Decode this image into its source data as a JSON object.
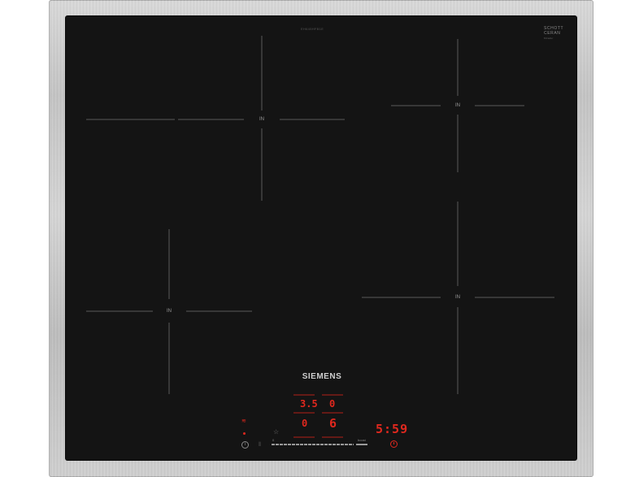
{
  "product": {
    "brand": "SIEMENS",
    "model_code": "EH645HFB1E",
    "glass_brand": "SCHOTT",
    "glass_line": "CERAN",
    "glass_sub": "Miradur"
  },
  "zones": [
    {
      "label": "IN"
    },
    {
      "label": "IN"
    },
    {
      "label": "IN"
    },
    {
      "label": "IN"
    }
  ],
  "controls": {
    "zone_displays": [
      {
        "value": "3.5"
      },
      {
        "value": "0"
      },
      {
        "value": "0"
      },
      {
        "value": "6"
      }
    ],
    "timer": "5:59",
    "slider_min_label": "0",
    "slider_max_label": "boost",
    "info_icon_glyph": "i",
    "lock_icon_glyph": "⦀",
    "favorite_icon_glyph": "☆",
    "wifi_icon_glyph": "≋"
  },
  "colors": {
    "display_red": "#e0281e",
    "glass": "#141414",
    "frame": "#c8c8c8"
  }
}
